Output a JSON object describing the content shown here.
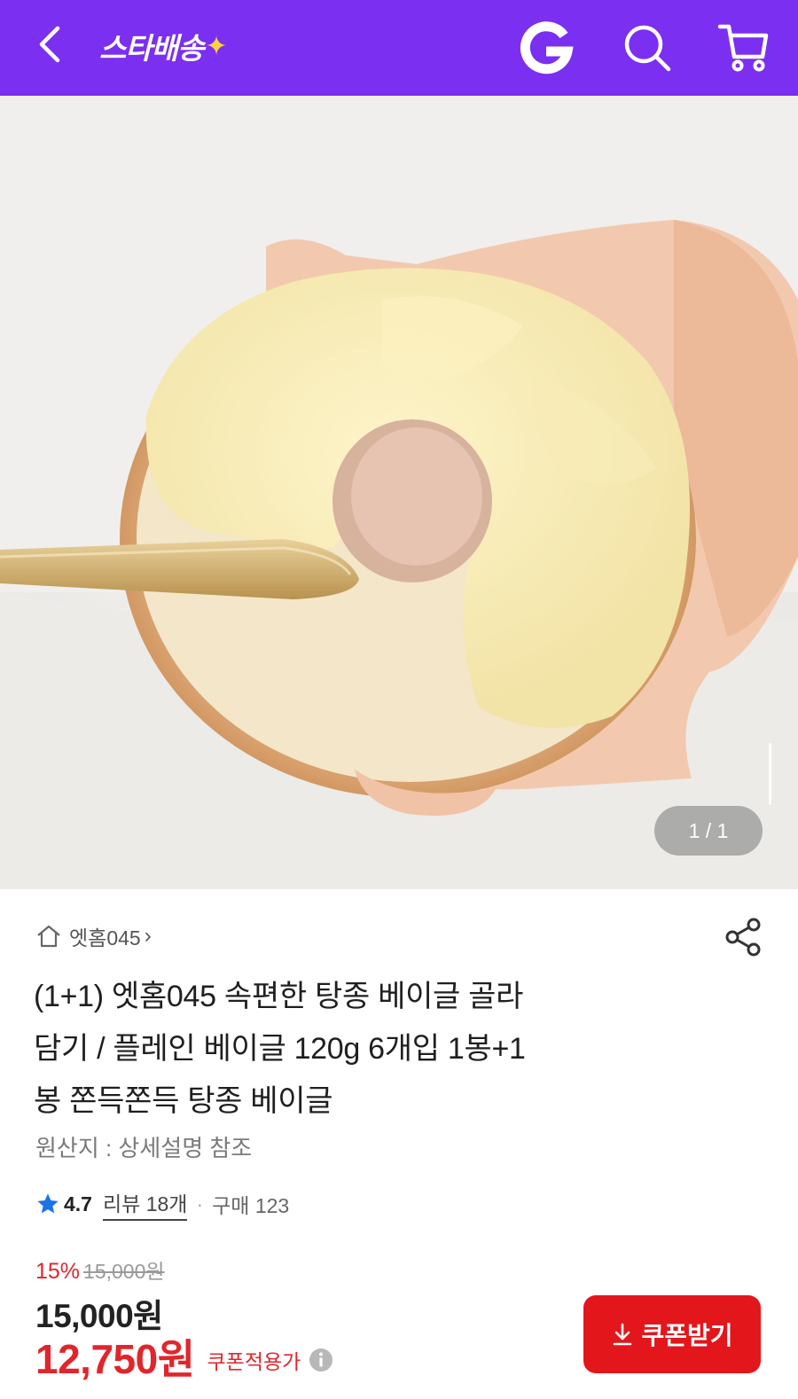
{
  "header": {
    "logo_text": "스타배송",
    "logo_spark": "✦",
    "g_label": "G",
    "bg_color": "#7b2ff0"
  },
  "icons": {
    "back": "back-arrow-icon",
    "search": "search-icon",
    "cart": "cart-icon",
    "share": "share-icon",
    "store": "home-icon",
    "star": "star-icon",
    "info": "info-icon",
    "download": "download-icon"
  },
  "gallery": {
    "counter": "1 / 1"
  },
  "product": {
    "store_name": "엣홈045",
    "store_chevron": "›",
    "title_lines": [
      "(1+1) 엣홈045 속편한 탕종 베이글 골라",
      "담기 / 플레인 베이글 120g 6개입 1봉+1",
      "봉 쫀득쫀득 탕종 베이글"
    ],
    "origin": "원산지 : 상세설명 참조",
    "rating": "4.7",
    "review_label": "리뷰 18개",
    "separator": "·",
    "purchase_label": "구매 123"
  },
  "price": {
    "discount_rate": "15%",
    "original_price": "15,000원",
    "sale_price": "15,000원",
    "coupon_price": "12,750원",
    "coupon_tag": "쿠폰적용가",
    "coupon_button": "쿠폰받기",
    "accent_color": "#e0262c"
  }
}
